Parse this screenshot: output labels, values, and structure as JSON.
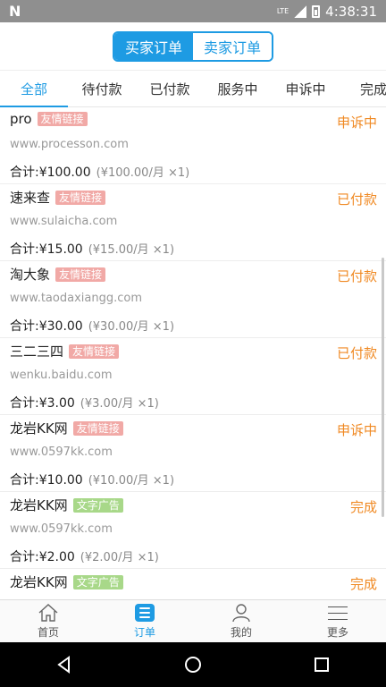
{
  "status_bar": {
    "time": "4:38:31",
    "network": "LTE"
  },
  "header": {
    "segments": [
      {
        "label": "买家订单",
        "active": true
      },
      {
        "label": "卖家订单",
        "active": false
      }
    ]
  },
  "tabs": [
    {
      "label": "全部",
      "active": true
    },
    {
      "label": "待付款"
    },
    {
      "label": "已付款"
    },
    {
      "label": "服务中"
    },
    {
      "label": "申诉中"
    },
    {
      "label": "完成"
    }
  ],
  "orders": [
    {
      "name": "pro",
      "tag": "友情链接",
      "tag_color": "#f1a9a6",
      "status": "申诉中",
      "url": "www.processon.com",
      "total": "合计:¥100.00",
      "detail": "(¥100.00/月 ×1)"
    },
    {
      "name": "速来查",
      "tag": "友情链接",
      "tag_color": "#f1a9a6",
      "status": "已付款",
      "url": "www.sulaicha.com",
      "total": "合计:¥15.00",
      "detail": "(¥15.00/月 ×1)"
    },
    {
      "name": "淘大象",
      "tag": "友情链接",
      "tag_color": "#f1a9a6",
      "status": "已付款",
      "url": "www.taodaxiangg.com",
      "total": "合计:¥30.00",
      "detail": "(¥30.00/月 ×1)"
    },
    {
      "name": "三二三四",
      "tag": "友情链接",
      "tag_color": "#f1a9a6",
      "status": "已付款",
      "url": "wenku.baidu.com",
      "total": "合计:¥3.00",
      "detail": "(¥3.00/月 ×1)"
    },
    {
      "name": "龙岩KK网",
      "tag": "友情链接",
      "tag_color": "#f1a9a6",
      "status": "申诉中",
      "url": "www.0597kk.com",
      "total": "合计:¥10.00",
      "detail": "(¥10.00/月 ×1)"
    },
    {
      "name": "龙岩KK网",
      "tag": "文字广告",
      "tag_color": "#a8d889",
      "status": "完成",
      "url": "www.0597kk.com",
      "total": "合计:¥2.00",
      "detail": "(¥2.00/月 ×1)"
    },
    {
      "name": "龙岩KK网",
      "tag": "文字广告",
      "tag_color": "#a8d889",
      "status": "完成",
      "url": "",
      "total": "",
      "detail": ""
    }
  ],
  "bottom_nav": [
    {
      "label": "首页",
      "icon": "home-icon",
      "active": false
    },
    {
      "label": "订单",
      "icon": "order-list-icon",
      "active": true
    },
    {
      "label": "我的",
      "icon": "user-icon",
      "active": false
    },
    {
      "label": "更多",
      "icon": "menu-icon",
      "active": false
    }
  ],
  "colors": {
    "accent": "#1e9be3",
    "status": "#f08a24"
  }
}
